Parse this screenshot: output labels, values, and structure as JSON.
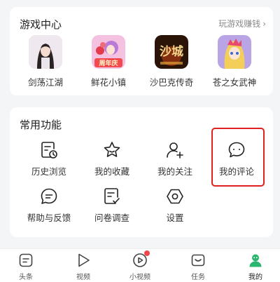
{
  "games_section": {
    "title": "游戏中心",
    "more_link": "玩游戏赚钱",
    "games": [
      {
        "name": "剑荡江湖"
      },
      {
        "name": "鲜花小镇",
        "badge": "周年庆"
      },
      {
        "name": "沙巴克传奇",
        "art_text": "沙城"
      },
      {
        "name": "苍之女武神"
      }
    ]
  },
  "functions_section": {
    "title": "常用功能",
    "items": [
      {
        "label": "历史浏览",
        "icon": "history-icon"
      },
      {
        "label": "我的收藏",
        "icon": "star-icon"
      },
      {
        "label": "我的关注",
        "icon": "add-user-icon"
      },
      {
        "label": "我的评论",
        "icon": "comment-icon"
      },
      {
        "label": "帮助与反馈",
        "icon": "help-chat-icon"
      },
      {
        "label": "问卷调查",
        "icon": "survey-icon"
      },
      {
        "label": "设置",
        "icon": "settings-icon"
      }
    ]
  },
  "tabbar": {
    "tabs": [
      {
        "label": "头条",
        "icon": "headline-icon"
      },
      {
        "label": "视频",
        "icon": "play-icon"
      },
      {
        "label": "小视频",
        "icon": "small-video-icon"
      },
      {
        "label": "任务",
        "icon": "task-icon"
      },
      {
        "label": "我的",
        "icon": "profile-icon",
        "active": true
      }
    ]
  },
  "colors": {
    "accent_green": "#2bb56f",
    "highlight_red": "#e0201e",
    "badge_red": "#f0474b"
  }
}
